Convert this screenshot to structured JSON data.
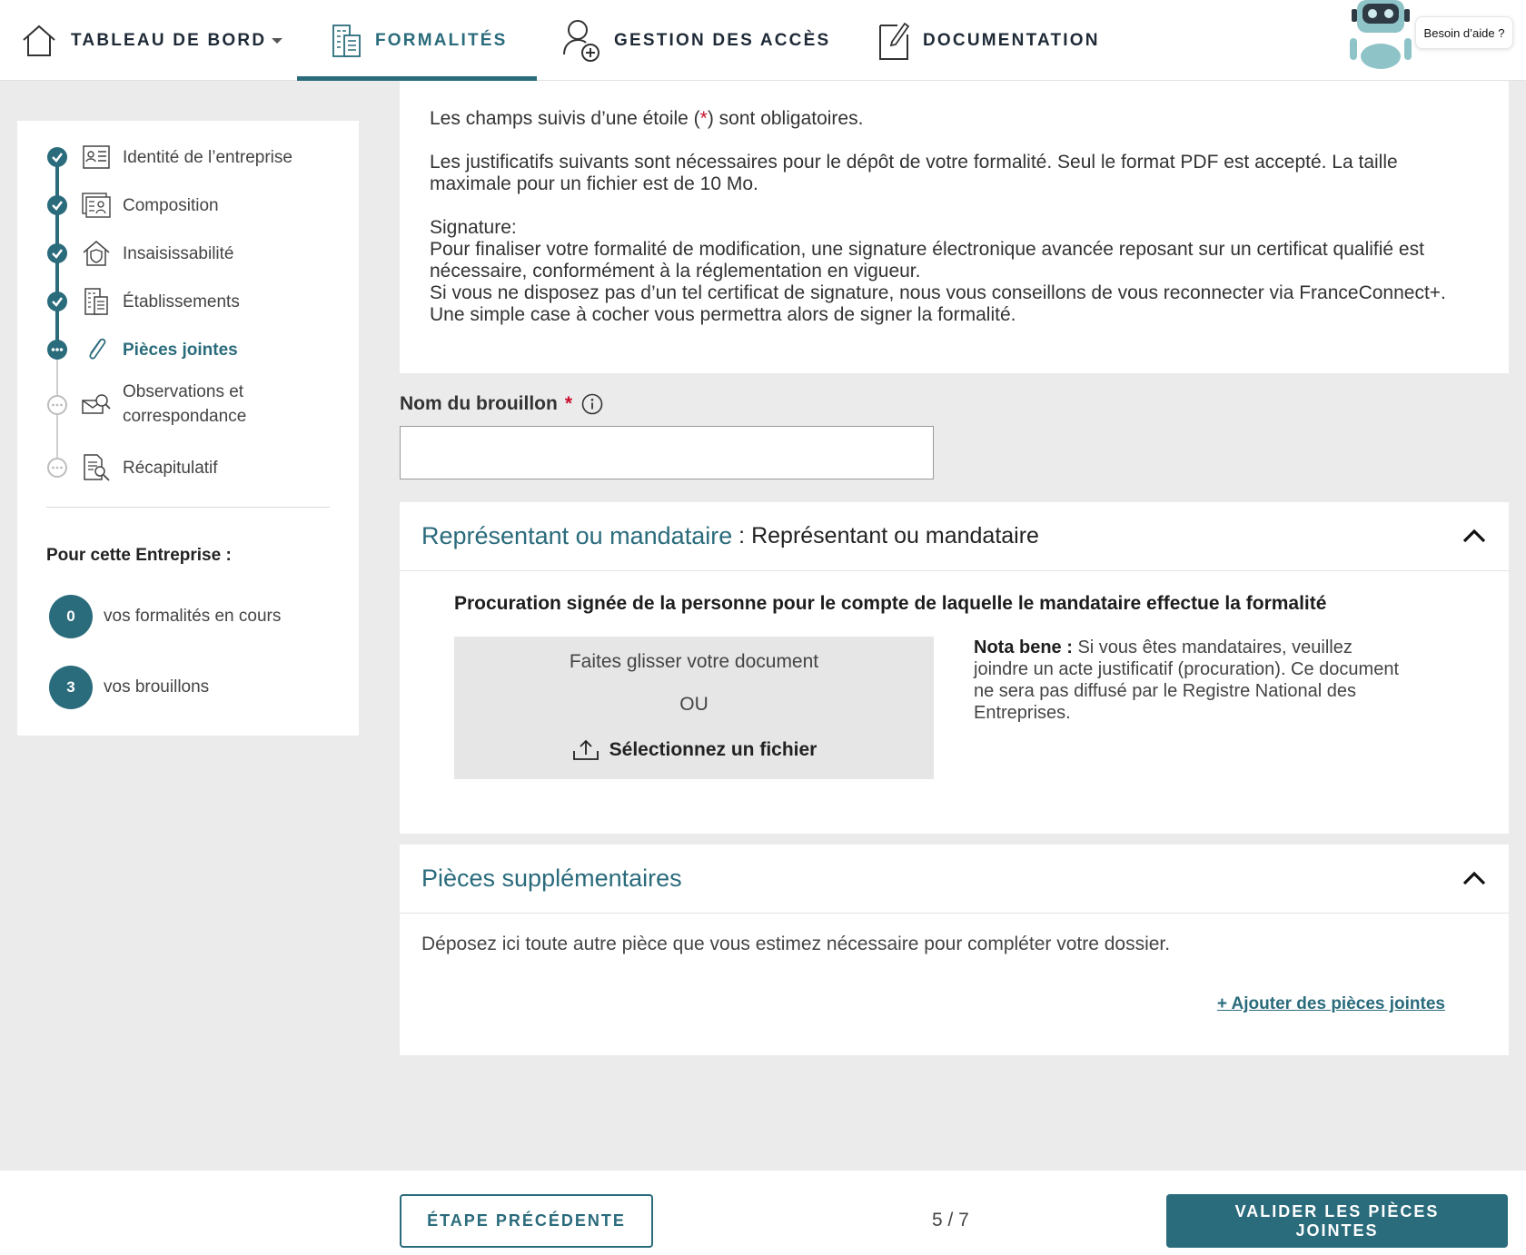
{
  "nav": {
    "items": [
      {
        "label": "TABLEAU DE BORD",
        "icon": "home-icon"
      },
      {
        "label": "FORMALITÉS",
        "icon": "building-document-icon",
        "active": true
      },
      {
        "label": "GESTION DES ACCÈS",
        "icon": "user-add-icon"
      },
      {
        "label": "DOCUMENTATION",
        "icon": "document-edit-icon"
      }
    ],
    "help_label": "Besoin d’aide ?"
  },
  "sidebar": {
    "steps": [
      {
        "label": "Identité de l’entreprise",
        "state": "done",
        "icon": "id-card-icon"
      },
      {
        "label": "Composition",
        "state": "done",
        "icon": "people-card-icon"
      },
      {
        "label": "Insaisissabilité",
        "state": "done",
        "icon": "house-shield-icon"
      },
      {
        "label": "Établissements",
        "state": "done",
        "icon": "building-icon"
      },
      {
        "label": "Pièces jointes",
        "state": "current",
        "icon": "paperclip-icon"
      },
      {
        "label_line1": "Observations et",
        "label_line2": "correspondance",
        "state": "todo",
        "icon": "mail-search-icon"
      },
      {
        "label": "Récapitulatif",
        "state": "todo",
        "icon": "document-search-icon"
      }
    ],
    "enterprise_title": "Pour cette Entreprise :",
    "counters": [
      {
        "value": "0",
        "label": "vos formalités en cours"
      },
      {
        "value": "3",
        "label": "vos brouillons"
      }
    ]
  },
  "intro": {
    "required_before": "Les champs suivis d’une étoile (",
    "required_star": "*",
    "required_after": ") sont obligatoires.",
    "justif": "Les justificatifs suivants sont nécessaires pour le dépôt de votre formalité. Seul le format PDF est accepté. La taille maximale pour un fichier est de 10 Mo.",
    "signature_title": "Signature:",
    "signature_text1": "Pour finaliser votre formalité de modification, une signature électronique avancée reposant sur un certificat qualifié est nécessaire, conformément à la réglementation en vigueur.",
    "signature_text2": "Si vous ne disposez pas d’un tel certificat de signature, nous vous conseillons de vous reconnecter via FranceConnect+. Une simple case à cocher vous permettra alors de signer la formalité."
  },
  "draft": {
    "label": "Nom du brouillon",
    "required": "*",
    "value": ""
  },
  "representative": {
    "title": "Représentant ou mandataire",
    "separator": " : ",
    "subtitle": "Représentant ou mandataire",
    "doc_title": "Procuration signée de la personne pour le compte de laquelle le mandataire effectue la formalité",
    "dropzone": {
      "drag": "Faites glisser votre document",
      "or": "OU",
      "select": "Sélectionnez un fichier"
    },
    "nota_label": "Nota bene :",
    "nota_text": " Si vous êtes mandataires, veuillez joindre un acte justificatif (procuration). Ce document ne sera pas diffusé par le Registre National des Entreprises."
  },
  "extra": {
    "title": "Pièces supplémentaires",
    "description": "Déposez ici toute autre pièce que vous estimez nécessaire pour compléter votre dossier.",
    "add_link": "+ Ajouter des pièces jointes"
  },
  "footer": {
    "prev": "ÉTAPE PRÉCÉDENTE",
    "pager": "5 / 7",
    "next": "VALIDER LES PIÈCES JOINTES"
  },
  "colors": {
    "accent": "#2a6b7c",
    "required": "#c8102e",
    "background": "#ebebeb"
  }
}
